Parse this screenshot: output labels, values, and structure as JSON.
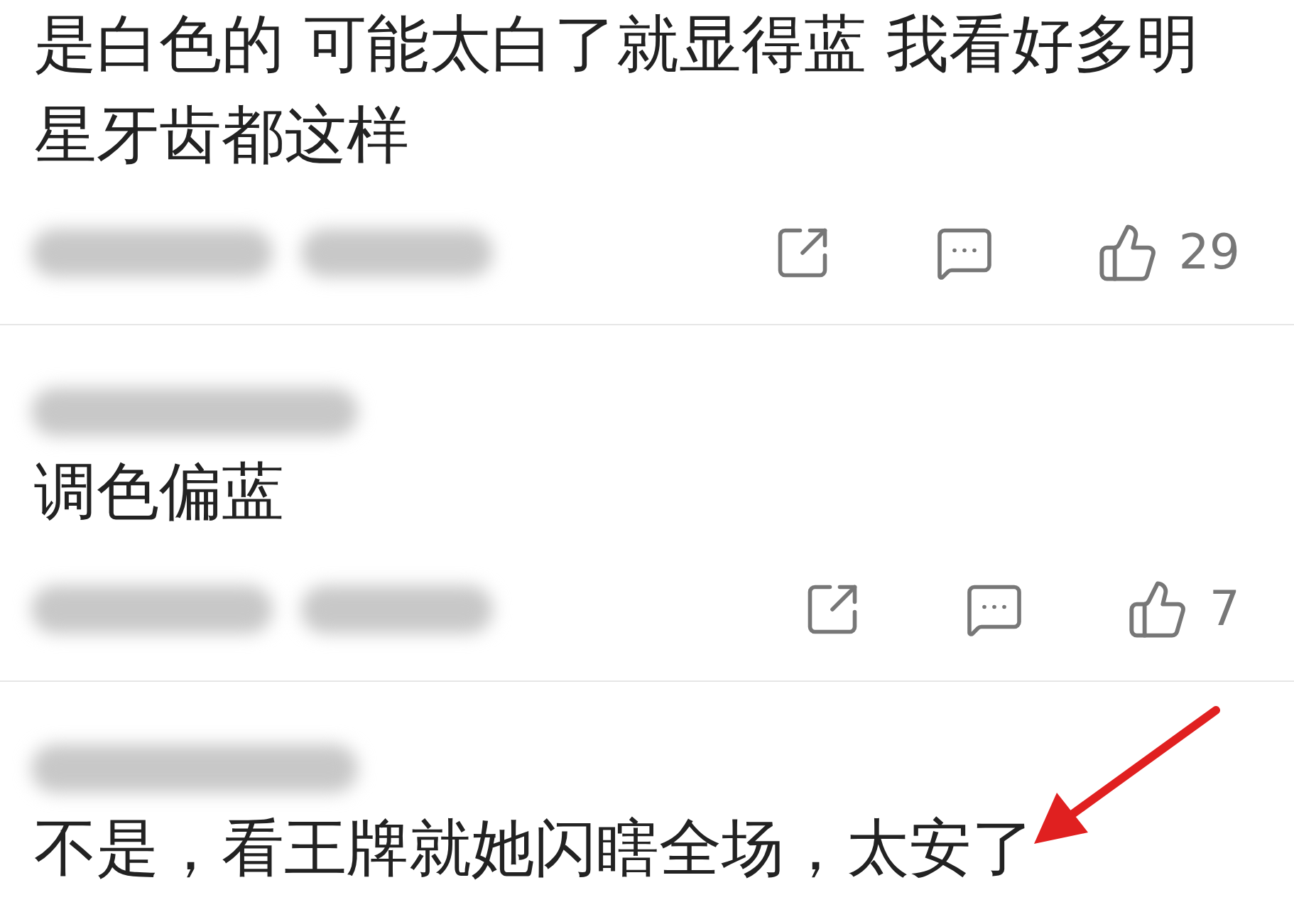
{
  "comments": [
    {
      "author_blurred": false,
      "text": "是白色的 可能太白了就显得蓝 我看好多明星牙齿都这样",
      "likes": "29"
    },
    {
      "author_blurred": true,
      "text": "调色偏蓝",
      "likes": "7"
    },
    {
      "author_blurred": true,
      "text": "不是，看王牌就她闪瞎全场，太安了"
    }
  ],
  "annotation_arrow": true
}
